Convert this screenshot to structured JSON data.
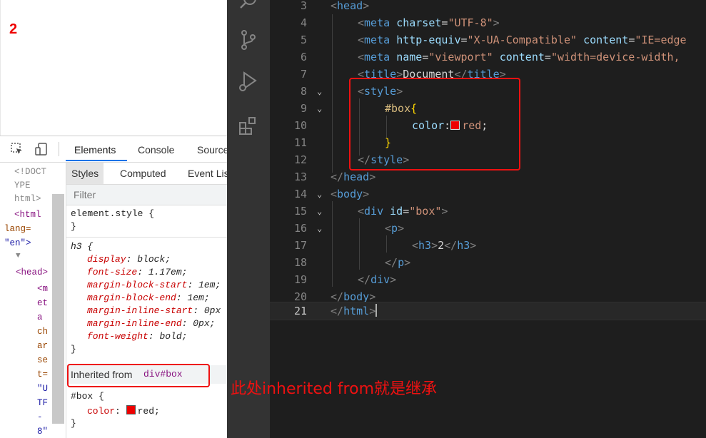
{
  "viewport": {
    "heading": "2"
  },
  "devtools": {
    "tabs": [
      "Elements",
      "Console",
      "Source"
    ],
    "subtabs": [
      "Styles",
      "Computed",
      "Event Lis"
    ],
    "filter_placeholder": "Filter",
    "dom_tree": {
      "line1": "<!DOCT",
      "line2": "YPE",
      "line3": "html>",
      "html_open": "<html",
      "lang_attr": "lang=",
      "lang_val": "\"en\">",
      "expander": "▼",
      "head_open": "<head>",
      "meta_chars": [
        "<m",
        "et",
        "a",
        "ch",
        "ar",
        "se",
        "t=",
        "\"U",
        "TF",
        "-",
        "8\""
      ]
    },
    "styles": {
      "element_style": "element.style {",
      "close_brace": "}",
      "h3_selector": "h3 {",
      "h3_rules": [
        {
          "prop": "display",
          "value": "block;"
        },
        {
          "prop": "font-size",
          "value": "1.17em;"
        },
        {
          "prop": "margin-block-start",
          "value": "1em;"
        },
        {
          "prop": "margin-block-end",
          "value": "1em;"
        },
        {
          "prop": "margin-inline-start",
          "value": "0px"
        },
        {
          "prop": "margin-inline-end",
          "value": "0px;"
        },
        {
          "prop": "font-weight",
          "value": "bold;"
        }
      ],
      "inherited_label": "Inherited from ",
      "inherited_selector": "div#box",
      "box_selector": "#box {",
      "box_prop": "color",
      "box_value": "red;"
    }
  },
  "editor": {
    "lines": [
      {
        "num": "3"
      },
      {
        "num": "4"
      },
      {
        "num": "5"
      },
      {
        "num": "6"
      },
      {
        "num": "7"
      },
      {
        "num": "8"
      },
      {
        "num": "9"
      },
      {
        "num": "10"
      },
      {
        "num": "11"
      },
      {
        "num": "12"
      },
      {
        "num": "13"
      },
      {
        "num": "14"
      },
      {
        "num": "15"
      },
      {
        "num": "16"
      },
      {
        "num": "17"
      },
      {
        "num": "18"
      },
      {
        "num": "19"
      },
      {
        "num": "20"
      },
      {
        "num": "21"
      }
    ],
    "code": {
      "l3_tag": "head",
      "l4_tag": "meta",
      "l4_attr": "charset",
      "l4_val": "\"UTF-8\"",
      "l5_tag": "meta",
      "l5_attr1": "http-equiv",
      "l5_val1": "\"X-UA-Compatible\"",
      "l5_attr2": "content",
      "l5_val2": "\"IE=edge",
      "l6_tag": "meta",
      "l6_attr1": "name",
      "l6_val1": "\"viewport\"",
      "l6_attr2": "content",
      "l6_val2": "\"width=device-width,",
      "l7_tag": "title",
      "l7_text": "Document",
      "l8_tag": "style",
      "l9_selector": "#box",
      "l10_prop": "color",
      "l10_value": "red",
      "l12_tag": "style",
      "l13_tag": "head",
      "l14_tag": "body",
      "l15_tag": "div",
      "l15_attr": "id",
      "l15_val": "\"box\"",
      "l16_tag": "p",
      "l17_tag": "h3",
      "l17_text": "2",
      "l18_tag": "p",
      "l19_tag": "div",
      "l20_tag": "body",
      "l21_tag": "html"
    }
  },
  "annotation": {
    "text": "此处inherited from就是继承"
  },
  "colors": {
    "annotation": "#ee1111",
    "devtools_accent": "#1a73e8",
    "editor_bg": "#1e1e1e"
  },
  "icons": [
    "inspect-icon",
    "device-toggle-icon",
    "search-icon",
    "source-control-icon",
    "run-debug-icon",
    "extensions-icon",
    "fold-chevron-icon"
  ]
}
